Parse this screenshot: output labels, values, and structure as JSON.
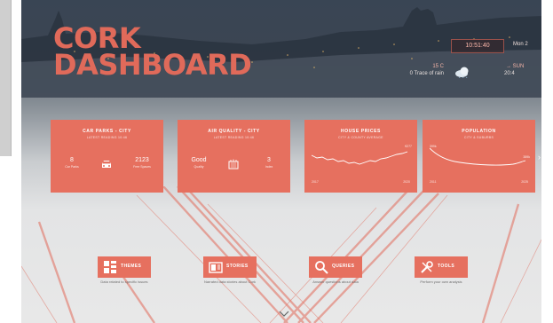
{
  "title": {
    "line1": "CORK",
    "line2": "DASHBOARD"
  },
  "widget": {
    "time": "10:51:40",
    "date": "Mon 2",
    "temperature": "15 C",
    "rain": "0 Trace of rain",
    "sunrise": "→ SUN",
    "sunset": "20:4"
  },
  "cards": [
    {
      "title": "CAR PARKS - CITY",
      "subtitle": "LATEST READING 10:46",
      "left_value": "8",
      "left_label": "Car Parks",
      "right_value": "2123",
      "right_label": "Free Spaces"
    },
    {
      "title": "AIR QUALITY - CITY",
      "subtitle": "LATEST READING 10:46",
      "left_value": "Good",
      "left_label": "Quality",
      "right_value": "3",
      "right_label": "Index"
    },
    {
      "title": "HOUSE PRICES",
      "subtitle": "CITY & COUNTY AVERAGE",
      "start_label": "",
      "end_label": "€277",
      "x_start": "2017",
      "x_end": "2020"
    },
    {
      "title": "POPULATION",
      "subtitle": "CITY & SUBURBS",
      "start_label": "399k",
      "end_label": "389k",
      "x_start": "2011",
      "x_end": "2025"
    }
  ],
  "nav": [
    {
      "label": "THEMES",
      "description": "Data related to specific issues"
    },
    {
      "label": "STORIES",
      "description": "Narrated data stories about Cork"
    },
    {
      "label": "QUERIES",
      "description": "Answer questions about data"
    },
    {
      "label": "TOOLS",
      "description": "Perform your own analysis"
    }
  ],
  "icons": {
    "car": "car-icon",
    "air": "building-icon",
    "themes": "grid-icon",
    "stories": "book-icon",
    "queries": "search-icon",
    "tools": "wrench-icon",
    "next": "chevron-right-icon",
    "scroll": "chevron-down-icon"
  },
  "colors": {
    "accent": "#e6705f",
    "title": "#e06a5a"
  }
}
